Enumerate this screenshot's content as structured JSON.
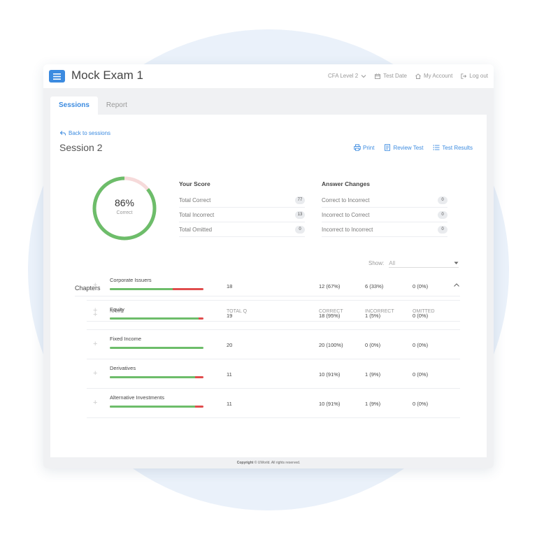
{
  "header": {
    "title": "Mock Exam 1",
    "level": "CFA Level 2",
    "test_date": "Test Date",
    "my_account": "My Account",
    "log_out": "Log out"
  },
  "tabs": [
    {
      "label": "Sessions",
      "active": true
    },
    {
      "label": "Report",
      "active": false
    }
  ],
  "back_label": "Back to sessions",
  "session_title": "Session 2",
  "actions": {
    "print": "Print",
    "review": "Review Test",
    "results": "Test Results"
  },
  "score": {
    "percent_label": "86%",
    "percent": 0.86,
    "caption": "Correct"
  },
  "your_score": {
    "title": "Your Score",
    "rows": [
      {
        "label": "Total Correct",
        "value": "77"
      },
      {
        "label": "Total Incorrect",
        "value": "13"
      },
      {
        "label": "Total Omitted",
        "value": "0"
      }
    ]
  },
  "answer_changes": {
    "title": "Answer Changes",
    "rows": [
      {
        "label": "Correct to Incorrect",
        "value": "0"
      },
      {
        "label": "Incorrect to Correct",
        "value": "0"
      },
      {
        "label": "Incorrect to Incorrect",
        "value": "0"
      }
    ]
  },
  "filter": {
    "label": "Show:",
    "value": "All"
  },
  "chapters": {
    "title": "Chapters",
    "columns": [
      "NAME",
      "TOTAL Q",
      "CORRECT",
      "INCORRECT",
      "OMITTED"
    ],
    "rows": [
      {
        "name": "Corporate Issuers",
        "total": "18",
        "correct": "12 (67%)",
        "incorrect": "6 (33%)",
        "omitted": "0 (0%)",
        "correct_fraction": 0.67
      },
      {
        "name": "Equity",
        "total": "19",
        "correct": "18 (95%)",
        "incorrect": "1 (5%)",
        "omitted": "0 (0%)",
        "correct_fraction": 0.95
      },
      {
        "name": "Fixed Income",
        "total": "20",
        "correct": "20 (100%)",
        "incorrect": "0 (0%)",
        "omitted": "0 (0%)",
        "correct_fraction": 1.0
      },
      {
        "name": "Derivatives",
        "total": "11",
        "correct": "10 (91%)",
        "incorrect": "1 (9%)",
        "omitted": "0 (0%)",
        "correct_fraction": 0.91
      },
      {
        "name": "Alternative Investments",
        "total": "11",
        "correct": "10 (91%)",
        "incorrect": "1 (9%)",
        "omitted": "0 (0%)",
        "correct_fraction": 0.91
      }
    ]
  },
  "footer": {
    "copyright_bold": "Copyright",
    "copyright_rest": "© UWorld. All rights reserved."
  },
  "colors": {
    "accent": "#3c8be0",
    "correct": "#6dbd6a",
    "incorrect": "#e04d4d",
    "donut_remainder": "#f6dada"
  },
  "icons": [
    "menu-icon",
    "chevron-down-icon",
    "calendar-icon",
    "home-icon",
    "logout-icon",
    "back-arrow-icon",
    "print-icon",
    "document-icon",
    "list-icon",
    "chevron-up-icon",
    "plus-icon"
  ]
}
